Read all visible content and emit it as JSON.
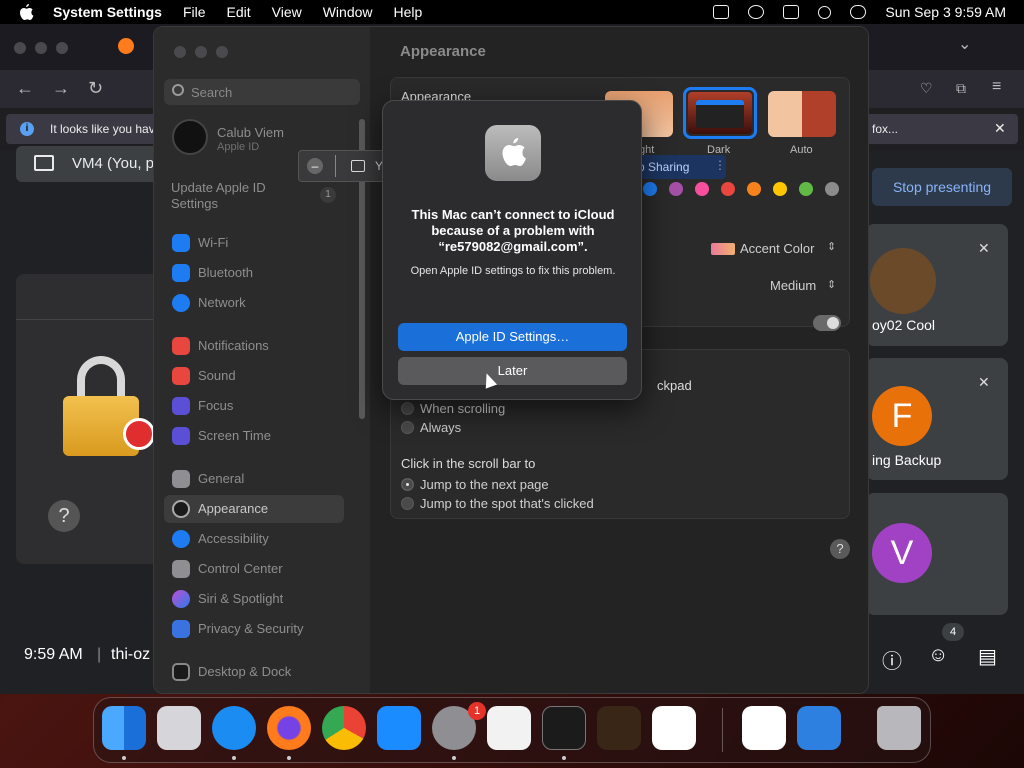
{
  "menubar": {
    "app_name": "System Settings",
    "items": [
      "File",
      "Edit",
      "View",
      "Window",
      "Help"
    ],
    "datetime": "Sun Sep 3  9:59 AM"
  },
  "browser": {
    "notification": "It looks like you have",
    "notification_suffix": "fox...",
    "share_label": "VM4 (You, p",
    "stop_presenting": "Stop presenting",
    "participants": [
      {
        "name": "oy02 Cool"
      },
      {
        "name": "ing Backup",
        "initial": "F",
        "color": "#e8710a"
      },
      {
        "name": "",
        "initial": "V",
        "color": "#a142c4"
      }
    ],
    "people_count": "4",
    "clock": "9:59 AM",
    "meeting_code": "thi-oz"
  },
  "settings": {
    "search_placeholder": "Search",
    "user_name": "Calub Viem",
    "user_sub": "Apple ID",
    "update_label": "Update Apple ID Settings",
    "update_badge": "1",
    "sidebar": [
      {
        "label": "Wi-Fi",
        "color": "#1e7cf2"
      },
      {
        "label": "Bluetooth",
        "color": "#1e7cf2"
      },
      {
        "label": "Network",
        "color": "#1e7cf2"
      },
      {
        "label": "Notifications",
        "color": "#e8473f"
      },
      {
        "label": "Sound",
        "color": "#e8473f"
      },
      {
        "label": "Focus",
        "color": "#5b4fd6"
      },
      {
        "label": "Screen Time",
        "color": "#5b4fd6"
      },
      {
        "label": "General",
        "color": "#8e8e93"
      },
      {
        "label": "Appearance",
        "color": "#2b2b2b"
      },
      {
        "label": "Accessibility",
        "color": "#1e7cf2"
      },
      {
        "label": "Control Center",
        "color": "#8e8e93"
      },
      {
        "label": "Siri & Spotlight",
        "color": "#c04fd6"
      },
      {
        "label": "Privacy & Security",
        "color": "#3a73e0"
      },
      {
        "label": "Desktop & Dock",
        "color": "#2b2b2b"
      }
    ],
    "page_title": "Appearance",
    "appearance_label": "Appearance",
    "appearance_options": [
      "ght",
      "Dark",
      "Auto"
    ],
    "accent_color_label": "Accent Color",
    "sidebar_icon_size": "Medium",
    "scroll_section_suffix": "ckpad",
    "scroll_options": [
      "When scrolling",
      "Always"
    ],
    "click_scroll_label": "Click in the scroll bar to",
    "click_scroll_options": [
      "Jump to the next page",
      "Jump to the spot that's clicked"
    ],
    "accent_colors": [
      "#1e7cf2",
      "#a550a7",
      "#f74f9e",
      "#e8473f",
      "#f7821b",
      "#ffc600",
      "#62ba46",
      "#8c8c8c"
    ],
    "help": "?"
  },
  "share_pill": {
    "label": "Y",
    "sharing": "p Sharing"
  },
  "alert": {
    "title": "This Mac can’t connect to iCloud because of a problem with “re579082@gmail.com”.",
    "body": "Open Apple ID settings to fix this problem.",
    "primary": "Apple ID Settings…",
    "secondary": "Later"
  },
  "dock": {
    "apps": [
      {
        "name": "finder-app",
        "color": "#3a8ef6"
      },
      {
        "name": "launchpad-app",
        "color": "#d6d6da"
      },
      {
        "name": "safari-app",
        "color": "#1b8df2"
      },
      {
        "name": "firefox-app",
        "color": "#ff7b1c"
      },
      {
        "name": "chrome-app",
        "color": "#f2f2f2"
      },
      {
        "name": "app-store-app",
        "color": "#1a8cff"
      },
      {
        "name": "system-settings-app",
        "color": "#8e8e93"
      },
      {
        "name": "textedit-app",
        "color": "#f2f2f2"
      },
      {
        "name": "terminal-app",
        "color": "#1b1b1b"
      },
      {
        "name": "garageband-app",
        "color": "#3a2616"
      },
      {
        "name": "vscode-app",
        "color": "#ffffff"
      },
      {
        "name": "visual-studio-app",
        "color": "#ffffff"
      },
      {
        "name": "weather-app",
        "color": "#2d7fe0"
      },
      {
        "name": "trash-app",
        "color": "#b8b8bc"
      }
    ],
    "settings_badge": "1"
  }
}
